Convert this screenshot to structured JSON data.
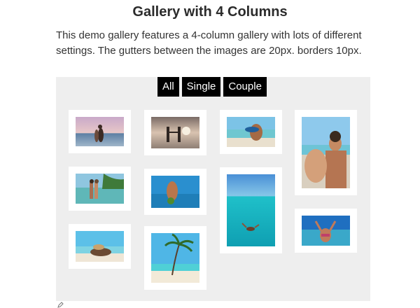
{
  "page": {
    "title": "Gallery with 4 Columns",
    "description": "This demo gallery features a 4-column gallery with lots of different settings. The gutters between the images are 20px. borders 10px."
  },
  "gallery": {
    "filters": [
      {
        "label": "All"
      },
      {
        "label": "Single"
      },
      {
        "label": "Couple"
      }
    ],
    "photos": [
      {
        "subject": "couple embracing at sunset beach"
      },
      {
        "subject": "couple holding hands on beach"
      },
      {
        "subject": "man carrying woman on beach"
      },
      {
        "subject": "smiling man with woman on beach"
      },
      {
        "subject": "couple kissing in shallow water"
      },
      {
        "subject": "woman in bikini holding coconut"
      },
      {
        "subject": "swimmer floating in turquoise sea"
      },
      {
        "subject": "woman raising arms in water"
      },
      {
        "subject": "woman with sun hat lying on beach"
      },
      {
        "subject": "palm tree over tropical beach"
      }
    ]
  },
  "footer": {
    "icon": "edit-icon"
  }
}
